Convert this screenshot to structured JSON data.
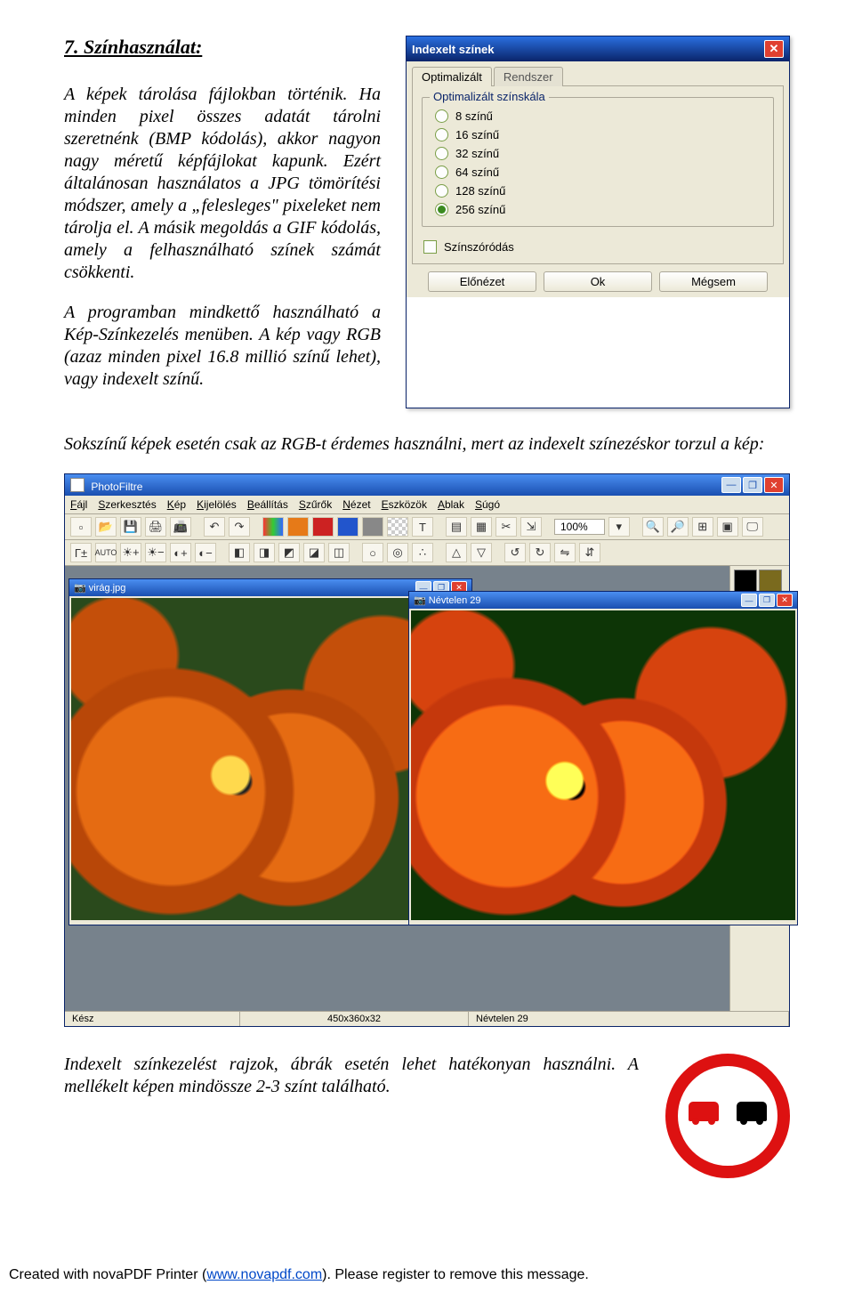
{
  "section": {
    "title": "7. Színhasználat:",
    "p1": "A képek tárolása fájlokban történik. Ha minden pixel összes adatát tárolni szeretnénk (BMP kódolás), akkor nagyon nagy méretű képfájlokat kapunk. Ezért általánosan használatos a JPG tömörítési módszer, amely a „felesleges\" pixeleket nem tárolja el. A másik megoldás a GIF kódolás, amely a felhasználható színek számát csökkenti.",
    "p2": "A programban mindkettő használható a Kép-Színkezelés menüben. A kép vagy RGB (azaz minden pixel 16.8 millió színű lehet), vagy indexelt színű.",
    "p3": "Sokszínű képek esetén csak az RGB-t érdemes használni, mert az indexelt színezéskor torzul a kép:",
    "p4": "Indexelt színkezelést rajzok, ábrák esetén lehet hatékonyan használni. A mellékelt képen mindössze 2-3 színt található."
  },
  "dialog": {
    "title": "Indexelt színek",
    "tabs": [
      "Optimalizált",
      "Rendszer"
    ],
    "group_legend": "Optimalizált színskála",
    "radios": [
      "8 színű",
      "16 színű",
      "32 színű",
      "64 színű",
      "128 színű",
      "256 színű"
    ],
    "radio_selected": 5,
    "checkbox": "Színszóródás",
    "buttons": [
      "Előnézet",
      "Ok",
      "Mégsem"
    ]
  },
  "photofiltre": {
    "title": "PhotoFiltre",
    "menus": [
      {
        "u": "F",
        "t": "ájl"
      },
      {
        "u": "S",
        "t": "zerkesztés"
      },
      {
        "u": "K",
        "t": "ép"
      },
      {
        "u": "K",
        "t": "ijelölés"
      },
      {
        "u": "B",
        "t": "eállítás"
      },
      {
        "u": "S",
        "t": "zűrők"
      },
      {
        "u": "N",
        "t": "ézet"
      },
      {
        "u": "E",
        "t": "szközök"
      },
      {
        "u": "A",
        "t": "blak"
      },
      {
        "u": "S",
        "t": "úgó"
      }
    ],
    "zoom": "100%",
    "image1_title": "virág.jpg",
    "image2_title": "Névtelen 29",
    "status": [
      "Kész",
      "450x360x32",
      "Névtelen 29"
    ]
  },
  "footer": {
    "pre": "Created with novaPDF Printer (",
    "link_text": "www.novapdf.com",
    "post": "). Please register to remove this message."
  }
}
